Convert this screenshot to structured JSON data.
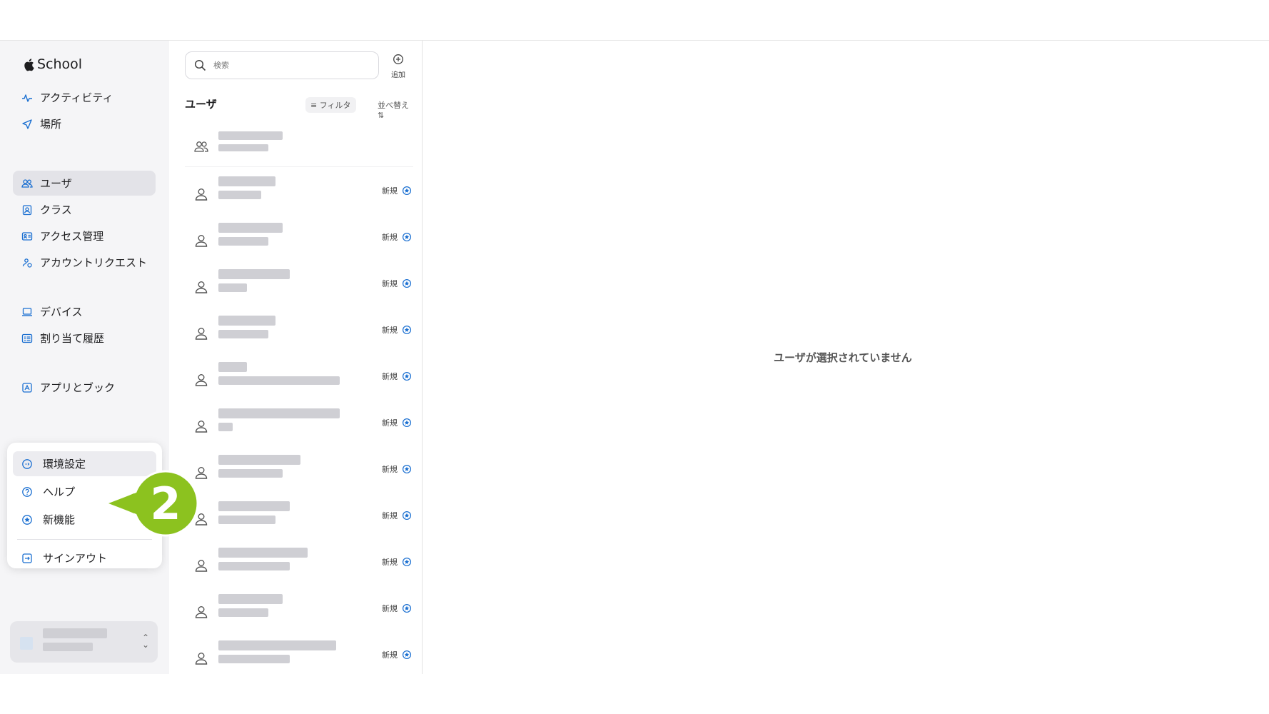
{
  "app": {
    "brand": "School"
  },
  "sidebar": {
    "group1": [
      {
        "label": "アクティビティ",
        "icon": "activity-icon"
      },
      {
        "label": "場所",
        "icon": "location-icon"
      }
    ],
    "group2": [
      {
        "label": "ユーザ",
        "icon": "users-icon",
        "active": true
      },
      {
        "label": "クラス",
        "icon": "class-icon"
      },
      {
        "label": "アクセス管理",
        "icon": "id-card-icon"
      },
      {
        "label": "アカウントリクエスト",
        "icon": "account-request-icon"
      }
    ],
    "group3": [
      {
        "label": "デバイス",
        "icon": "laptop-icon"
      },
      {
        "label": "割り当て履歴",
        "icon": "history-icon"
      }
    ],
    "group4": [
      {
        "label": "アプリとブック",
        "icon": "app-store-icon"
      }
    ]
  },
  "popup_menu": {
    "items": [
      {
        "label": "環境設定",
        "icon": "preferences-icon"
      },
      {
        "label": "ヘルプ",
        "icon": "help-icon"
      },
      {
        "label": "新機能",
        "icon": "star-badge-icon"
      }
    ],
    "signout": {
      "label": "サインアウト",
      "icon": "signout-icon"
    }
  },
  "callout": {
    "number": "2",
    "color": "#8cc21f"
  },
  "list": {
    "search_placeholder": "検索",
    "add_label": "追加",
    "title": "ユーザ",
    "filter_label": "フィルタ",
    "sort_label": "並べ替え",
    "badge_label": "新規",
    "row_count": 11
  },
  "detail": {
    "empty_message": "ユーザが選択されていません"
  },
  "colors": {
    "accent": "#1a6fd1",
    "sidebar_bg": "#f5f5f7",
    "active_bg": "#e3e3e8"
  }
}
